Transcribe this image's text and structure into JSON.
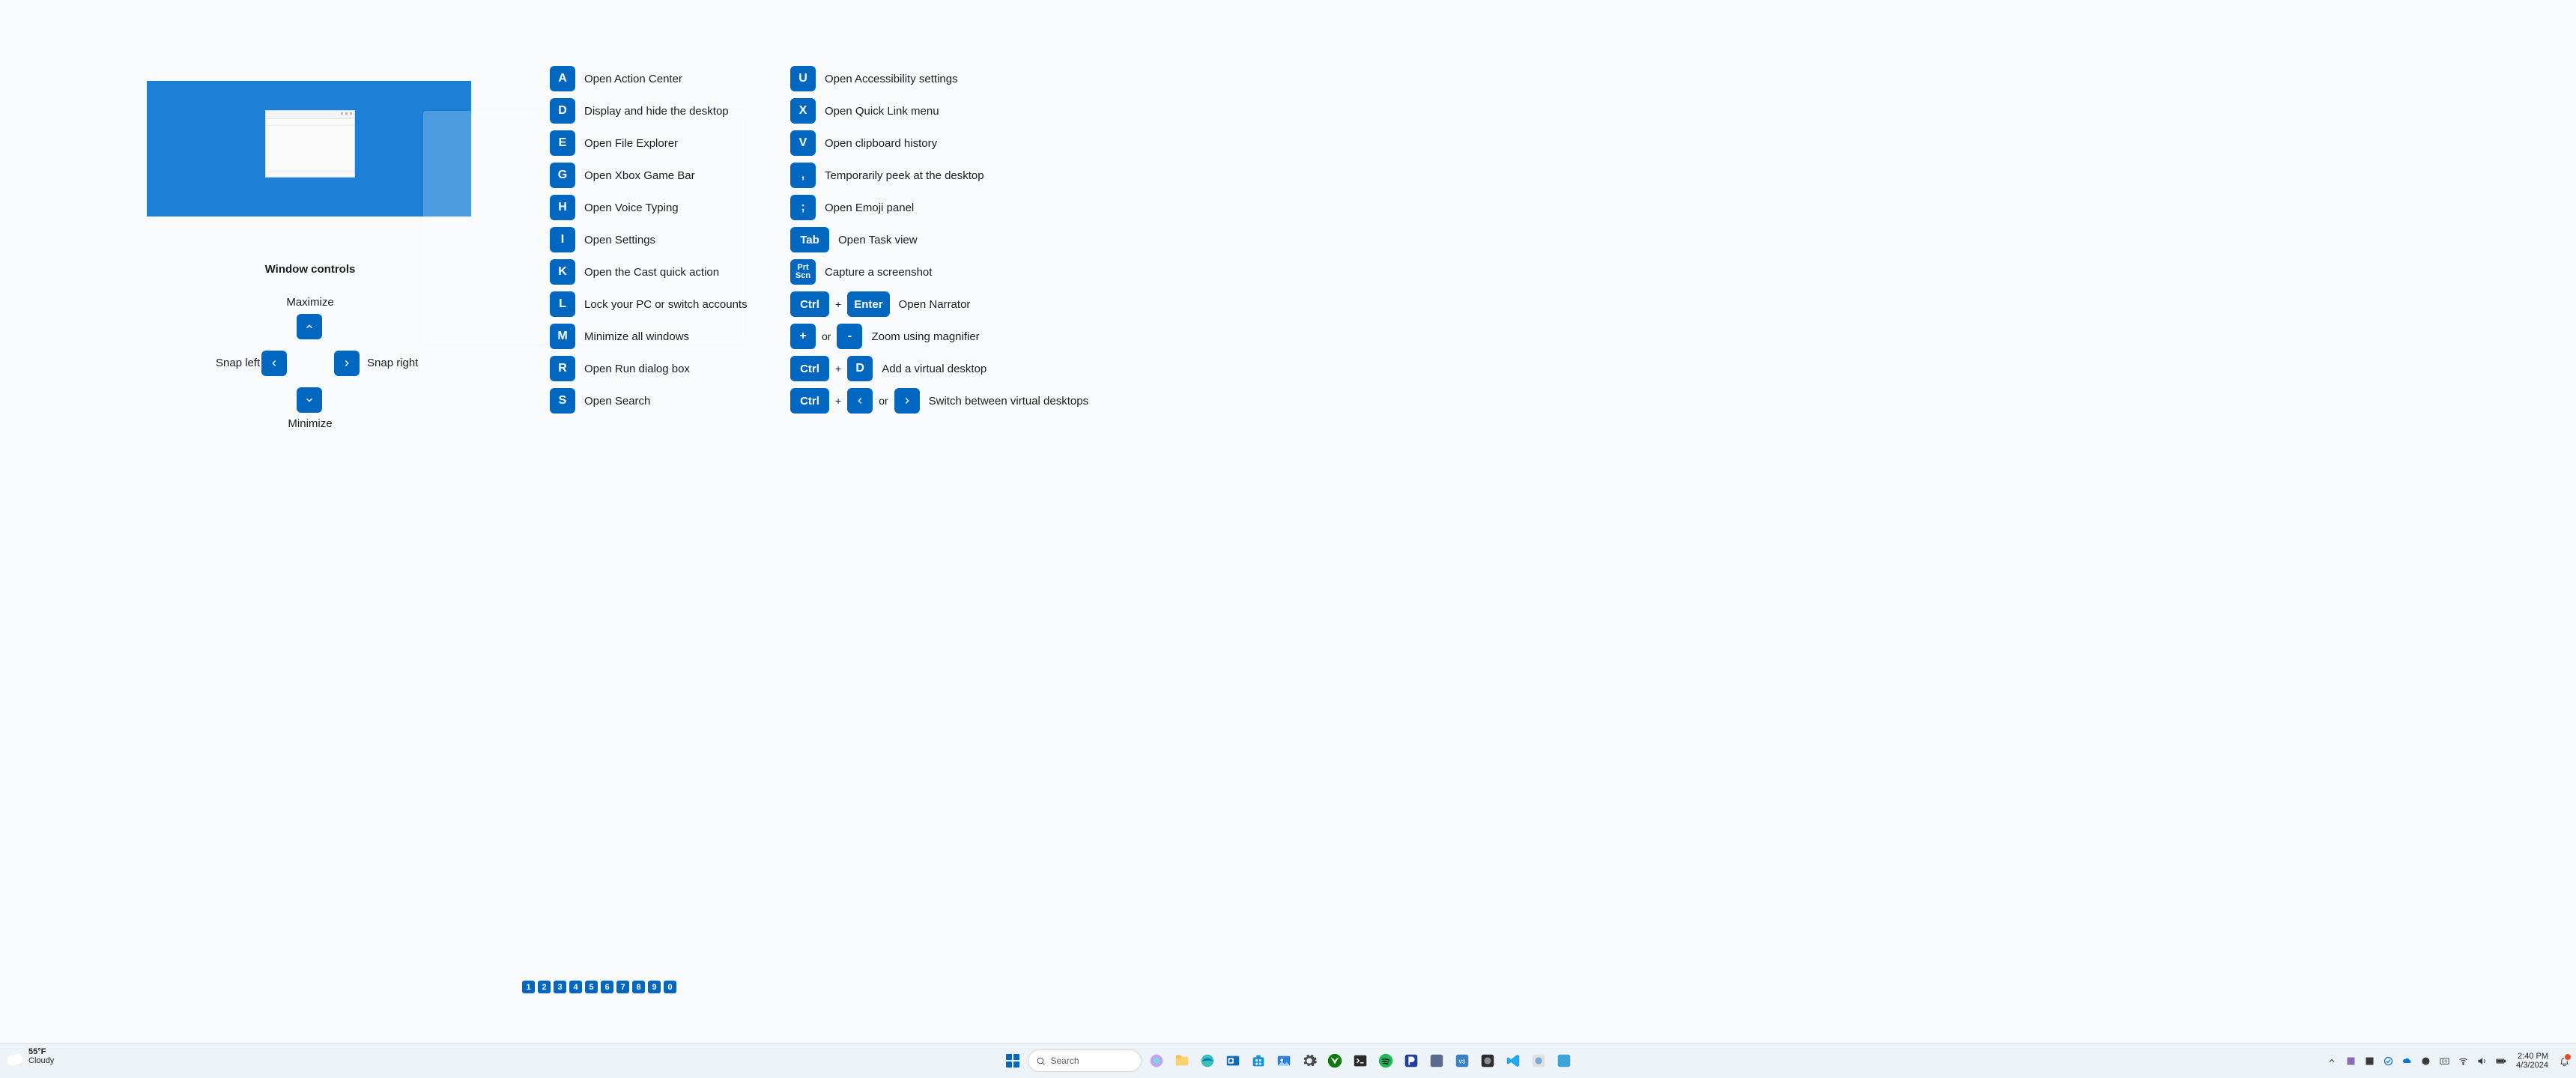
{
  "hero": {
    "alt": "Desktop wallpaper preview showing a File Explorer window"
  },
  "window_controls": {
    "title": "Window controls",
    "maximize": "Maximize",
    "minimize": "Minimize",
    "snap_left": "Snap left",
    "snap_right": "Snap right"
  },
  "shortcuts_left": [
    {
      "keys": [
        {
          "label": "A"
        }
      ],
      "desc": "Open Action Center"
    },
    {
      "keys": [
        {
          "label": "D"
        }
      ],
      "desc": "Display and hide the desktop"
    },
    {
      "keys": [
        {
          "label": "E"
        }
      ],
      "desc": "Open File Explorer"
    },
    {
      "keys": [
        {
          "label": "G"
        }
      ],
      "desc": "Open Xbox Game Bar"
    },
    {
      "keys": [
        {
          "label": "H"
        }
      ],
      "desc": "Open Voice Typing"
    },
    {
      "keys": [
        {
          "label": "I"
        }
      ],
      "desc": "Open Settings"
    },
    {
      "keys": [
        {
          "label": "K"
        }
      ],
      "desc": "Open the Cast quick action"
    },
    {
      "keys": [
        {
          "label": "L"
        }
      ],
      "desc": "Lock your PC or switch accounts"
    },
    {
      "keys": [
        {
          "label": "M"
        }
      ],
      "desc": "Minimize all windows"
    },
    {
      "keys": [
        {
          "label": "R"
        }
      ],
      "desc": "Open Run dialog box"
    },
    {
      "keys": [
        {
          "label": "S"
        }
      ],
      "desc": "Open Search"
    }
  ],
  "shortcuts_right": [
    {
      "keys": [
        {
          "label": "U"
        }
      ],
      "desc": "Open Accessibility settings"
    },
    {
      "keys": [
        {
          "label": "X"
        }
      ],
      "desc": "Open Quick Link menu"
    },
    {
      "keys": [
        {
          "label": "V"
        }
      ],
      "desc": "Open clipboard history"
    },
    {
      "keys": [
        {
          "label": ","
        }
      ],
      "desc": "Temporarily peek at the desktop"
    },
    {
      "keys": [
        {
          "label": ";"
        }
      ],
      "desc": "Open Emoji panel"
    },
    {
      "keys": [
        {
          "label": "Tab",
          "wide": true
        }
      ],
      "desc": "Open Task view"
    },
    {
      "keys": [
        {
          "label": "Prt Scn",
          "tall": true
        }
      ],
      "desc": "Capture a screenshot"
    },
    {
      "keys": [
        {
          "label": "Ctrl",
          "wide": true
        },
        {
          "sep": "+"
        },
        {
          "label": "Enter",
          "wide": true
        }
      ],
      "desc": "Open Narrator"
    },
    {
      "keys": [
        {
          "label": "+"
        },
        {
          "sep": "or"
        },
        {
          "label": "-"
        }
      ],
      "desc": "Zoom using magnifier"
    },
    {
      "keys": [
        {
          "label": "Ctrl",
          "wide": true
        },
        {
          "sep": "+"
        },
        {
          "label": "D"
        }
      ],
      "desc": "Add a virtual desktop"
    },
    {
      "keys": [
        {
          "label": "Ctrl",
          "wide": true
        },
        {
          "sep": "+"
        },
        {
          "arrow": "left"
        },
        {
          "sep": "or"
        },
        {
          "arrow": "right"
        }
      ],
      "desc": "Switch between virtual desktops"
    }
  ],
  "pagination": [
    "1",
    "2",
    "3",
    "4",
    "5",
    "6",
    "7",
    "8",
    "9",
    "0"
  ],
  "taskbar": {
    "weather": {
      "temp": "55°F",
      "cond": "Cloudy"
    },
    "search_placeholder": "Search",
    "time": "2:40 PM",
    "date": "4/3/2024"
  }
}
